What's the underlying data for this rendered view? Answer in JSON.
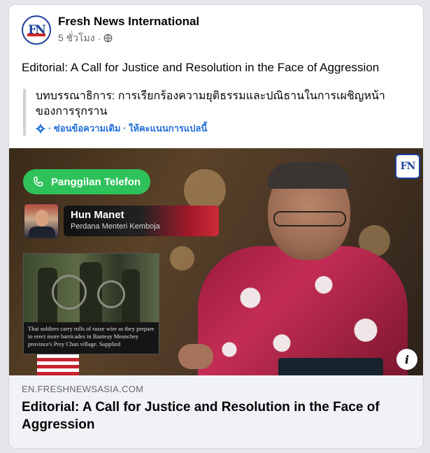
{
  "post": {
    "author": "Fresh News International",
    "timestamp": "5 ชั่วโมง",
    "separator": "·",
    "visibility_icon": "globe-icon",
    "text": "Editorial: A Call for Justice and Resolution in the Face of Aggression"
  },
  "translation": {
    "text": "บทบรรณาธิการ: การเรียกร้องความยุติธรรมและปณิธานในการเผชิญหน้าของการรุกราน",
    "actions": "· ซ่อนข้อความเดิม · ให้คะแนนการแปลนี้"
  },
  "preview": {
    "call_label": "Panggilan Telefon",
    "caller_name": "Hun Manet",
    "caller_role": "Perdana Menteri Kemboja",
    "news_caption": "Thai soldiers carry rolls of razor wire as they prepare to erect more barricades in Banteay Meanchey province's Prey Chan village. Supplied",
    "logo_text": "FN",
    "info_label": "i"
  },
  "link": {
    "domain": "EN.FRESHNEWSASIA.COM",
    "title": "Editorial: A Call for Justice and Resolution in the Face of Aggression"
  },
  "avatar": {
    "text": "FN"
  },
  "colors": {
    "link_blue": "#216fdb",
    "call_green": "#2fc25a",
    "brand_blue": "#1e3f9a",
    "secondary_text": "#65676b",
    "footer_bg": "#f0f2f5"
  }
}
